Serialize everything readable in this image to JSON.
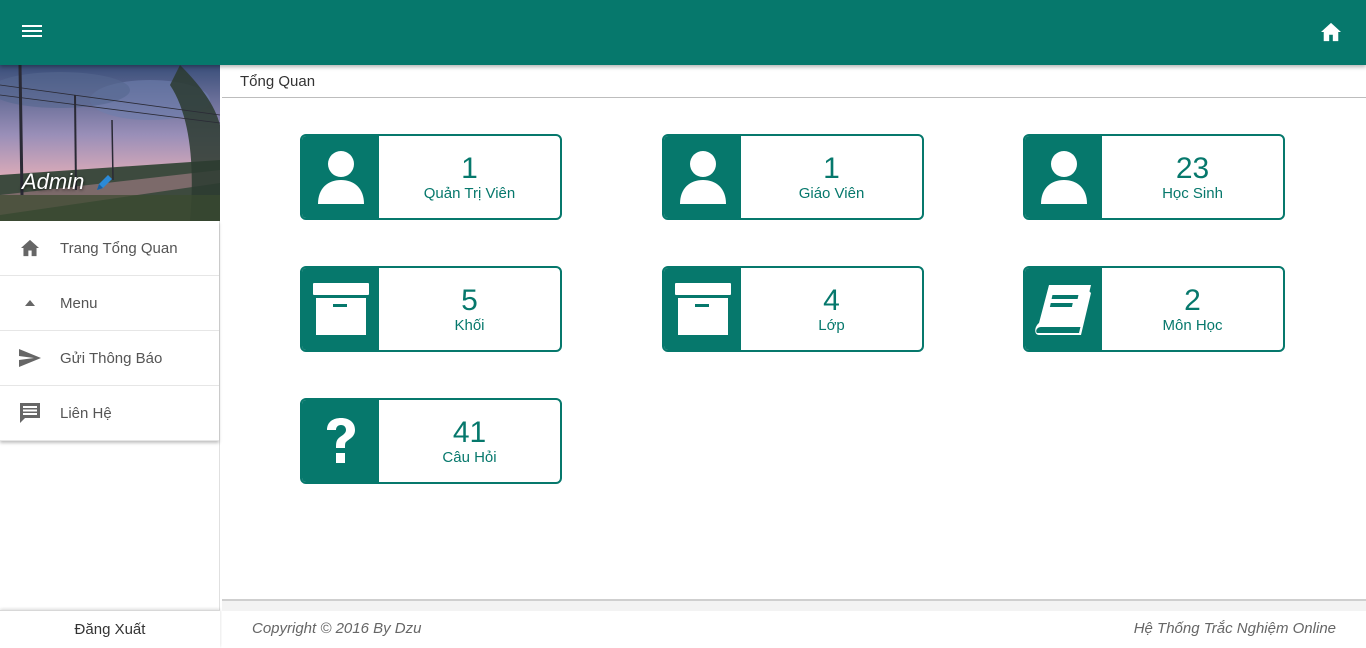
{
  "topbar": {
    "menu_icon": "hamburger-icon",
    "home_icon": "home-icon",
    "color": "#06786c"
  },
  "profile": {
    "name": "Admin",
    "edit_icon": "pencil-icon"
  },
  "sidebar": {
    "items": [
      {
        "label": "Trang Tổng Quan",
        "icon": "home-icon"
      },
      {
        "label": "Menu",
        "icon": "caret-up-icon"
      },
      {
        "label": "Gửi Thông Báo",
        "icon": "send-icon"
      },
      {
        "label": "Liên Hệ",
        "icon": "chat-icon"
      }
    ],
    "logout_label": "Đăng Xuất"
  },
  "breadcrumb": {
    "title": "Tổng Quan"
  },
  "cards": [
    {
      "value": "1",
      "label": "Quản Trị Viên",
      "icon": "user-icon"
    },
    {
      "value": "1",
      "label": "Giáo Viên",
      "icon": "user-icon"
    },
    {
      "value": "23",
      "label": "Học Sinh",
      "icon": "user-icon"
    },
    {
      "value": "5",
      "label": "Khối",
      "icon": "archive-icon"
    },
    {
      "value": "4",
      "label": "Lớp",
      "icon": "archive-icon"
    },
    {
      "value": "2",
      "label": "Môn Học",
      "icon": "book-icon"
    },
    {
      "value": "41",
      "label": "Câu Hỏi",
      "icon": "question-icon"
    }
  ],
  "footer": {
    "copyright": "Copyright © 2016 By Dzu",
    "system_name": "Hệ Thống Trắc Nghiệm Online"
  }
}
